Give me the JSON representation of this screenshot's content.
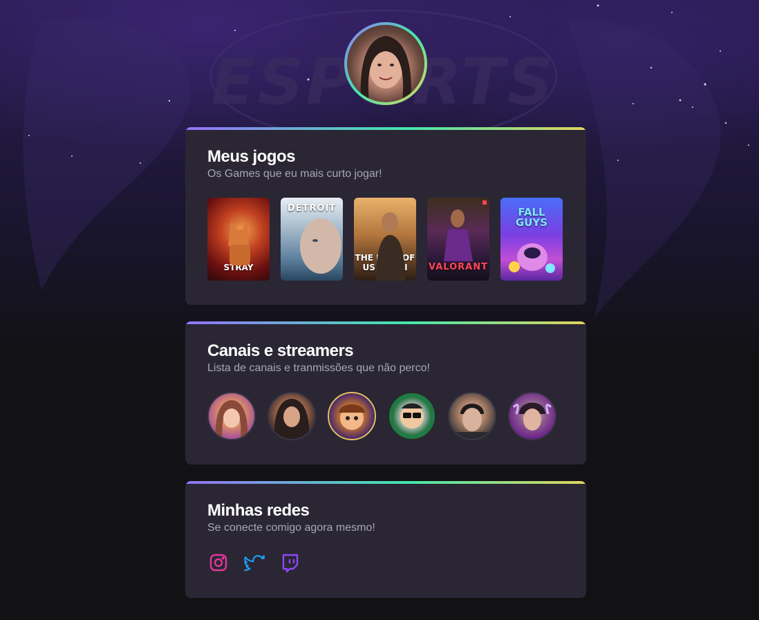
{
  "profile": {
    "avatar_alt": "Foto de perfil"
  },
  "sections": {
    "games": {
      "title": "Meus jogos",
      "subtitle": "Os Games que eu mais curto jogar!",
      "items": [
        {
          "name": "STRAY"
        },
        {
          "name": "DETROIT"
        },
        {
          "name": "THE LAST OF US PART I"
        },
        {
          "name": "VALORANT"
        },
        {
          "name": "FALL GUYS"
        }
      ]
    },
    "streamers": {
      "title": "Canais e streamers",
      "subtitle": "Lista de canais e tranmissões que não perco!"
    },
    "socials": {
      "title": "Minhas redes",
      "subtitle": "Se conecte comigo agora mesmo!",
      "items": [
        {
          "icon": "instagram-icon",
          "color": "#e0389c"
        },
        {
          "icon": "twitter-icon",
          "color": "#1d9bf0"
        },
        {
          "icon": "twitch-icon",
          "color": "#9146ff"
        }
      ]
    }
  },
  "colors": {
    "background": "#121214",
    "card": "#2a2634",
    "gradient_start": "#9572fc",
    "gradient_mid": "#43e7ad",
    "gradient_end": "#e2d45c"
  }
}
